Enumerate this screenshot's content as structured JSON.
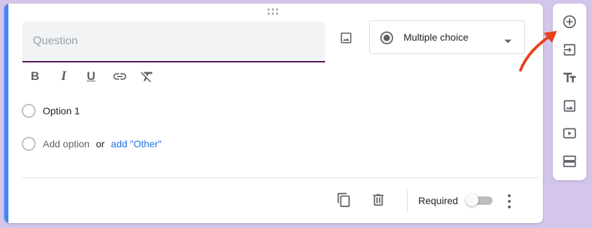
{
  "question": {
    "placeholder": "Question",
    "value": ""
  },
  "question_type": {
    "selected": "Multiple choice",
    "icon": "radio-button-icon"
  },
  "formatting": [
    {
      "name": "bold",
      "label": "B"
    },
    {
      "name": "italic",
      "label": "I"
    },
    {
      "name": "underline",
      "label": "U"
    },
    {
      "name": "link",
      "label": ""
    },
    {
      "name": "clear-formatting",
      "label": ""
    }
  ],
  "options": [
    {
      "label": "Option 1"
    }
  ],
  "add_option": {
    "label": "Add option",
    "or": "or",
    "other": "add \"Other\""
  },
  "footer": {
    "required_label": "Required",
    "required": false
  },
  "side_toolbar": [
    "add-question-icon",
    "import-questions-icon",
    "add-title-description-icon",
    "add-image-icon",
    "add-video-icon",
    "add-section-icon"
  ],
  "colors": {
    "accent": "#4285f4",
    "link": "#1a73e8",
    "annotation_arrow": "#e8401c",
    "background": "#d4c5ea",
    "underline": "#4a154b"
  }
}
